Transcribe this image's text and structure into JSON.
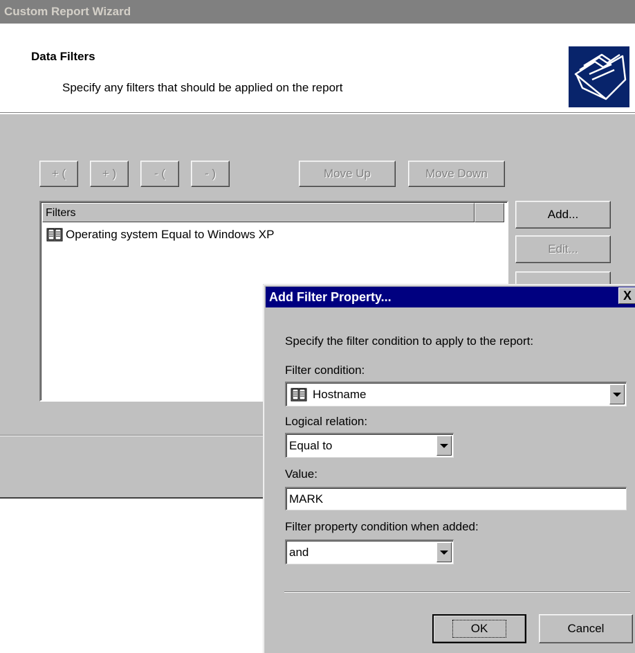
{
  "wizard": {
    "title": "Custom Report Wizard",
    "header_title": "Data Filters",
    "header_subtitle": "Specify any filters that should be applied on the report",
    "header_icon": "folders-icon",
    "toolbar": {
      "open_paren_plus": "+ (",
      "close_paren_plus": "+ )",
      "open_paren_minus": "- (",
      "close_paren_minus": "- )",
      "move_up": "Move Up",
      "move_down": "Move Down"
    },
    "list": {
      "column_header": "Filters",
      "rows": [
        "Operating system Equal to Windows XP"
      ]
    },
    "side_buttons": {
      "add": "Add...",
      "edit": "Edit..."
    }
  },
  "dialog": {
    "title": "Add Filter Property...",
    "close_label": "X",
    "instruction": "Specify the filter condition to apply to the report:",
    "filter_condition_label": "Filter condition:",
    "filter_condition_value": "Hostname",
    "logical_relation_label": "Logical relation:",
    "logical_relation_value": "Equal to",
    "value_label": "Value:",
    "value_value": "MARK",
    "added_condition_label": "Filter property condition when added:",
    "added_condition_value": "and",
    "ok_label": "OK",
    "cancel_label": "Cancel"
  },
  "colors": {
    "titlebar_active": "#000080",
    "titlebar_inactive": "#808080",
    "face": "#c0c0c0",
    "icon_bg": "#08246b"
  }
}
